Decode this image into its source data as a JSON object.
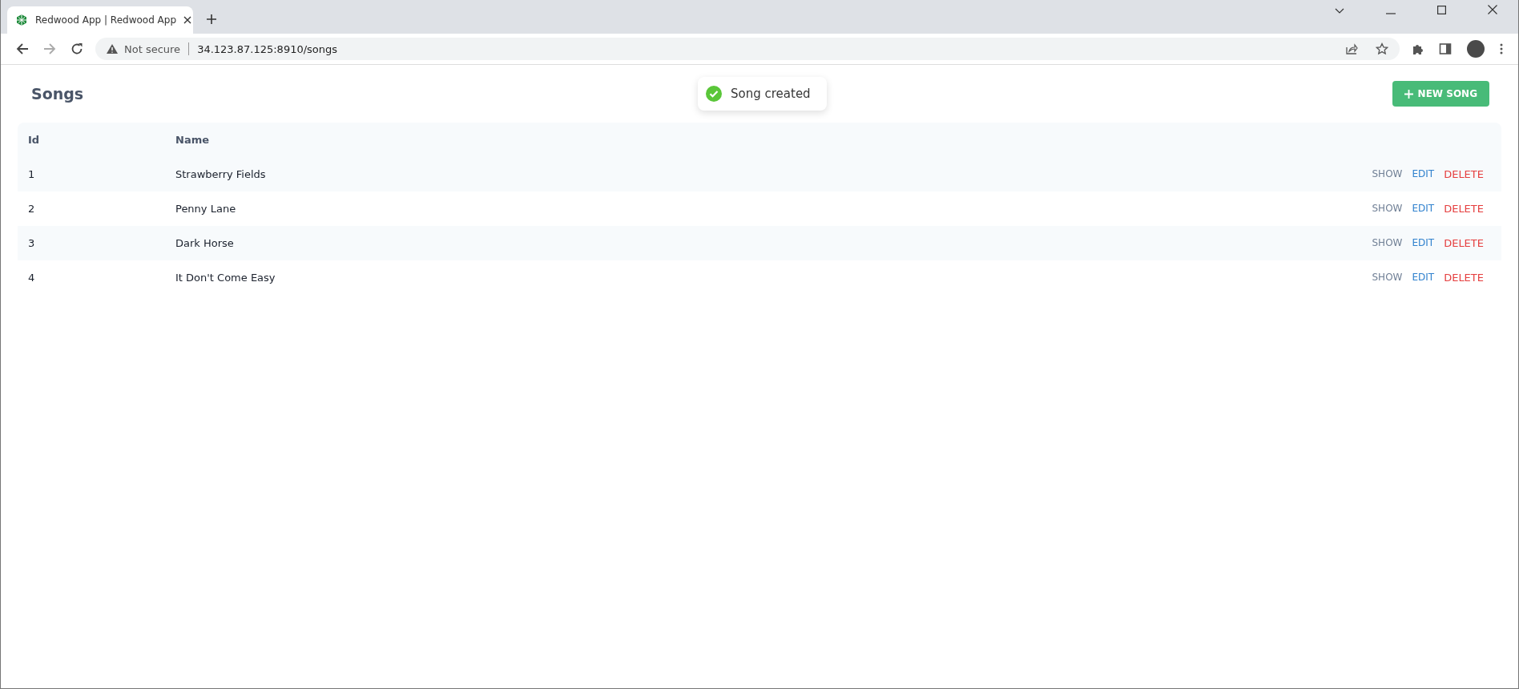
{
  "browser": {
    "tab": {
      "title": "Redwood App | Redwood App",
      "selected": true
    },
    "address": {
      "security": "Not secure",
      "url": "34.123.87.125:8910/songs"
    }
  },
  "page": {
    "title": "Songs",
    "new_button": "NEW SONG"
  },
  "toast": {
    "kind": "success",
    "message": "Song created"
  },
  "table": {
    "columns": [
      "Id",
      "Name"
    ],
    "rows": [
      {
        "id": "1",
        "name": "Strawberry Fields",
        "actions": [
          {
            "label": "SHOW",
            "kind": "show"
          },
          {
            "label": "EDIT",
            "kind": "edit"
          },
          {
            "label": "DELETE",
            "kind": "delete"
          }
        ]
      },
      {
        "id": "2",
        "name": "Penny Lane",
        "actions": [
          {
            "label": "SHOW",
            "kind": "show"
          },
          {
            "label": "EDIT",
            "kind": "edit"
          },
          {
            "label": "DELETE",
            "kind": "delete"
          }
        ]
      },
      {
        "id": "3",
        "name": "Dark Horse",
        "actions": [
          {
            "label": "SHOW",
            "kind": "show"
          },
          {
            "label": "EDIT",
            "kind": "edit"
          },
          {
            "label": "DELETE",
            "kind": "delete"
          }
        ]
      },
      {
        "id": "4",
        "name": "It Don't Come Easy",
        "actions": [
          {
            "label": "SHOW",
            "kind": "show"
          },
          {
            "label": "EDIT",
            "kind": "edit"
          },
          {
            "label": "DELETE",
            "kind": "delete"
          }
        ]
      }
    ]
  }
}
